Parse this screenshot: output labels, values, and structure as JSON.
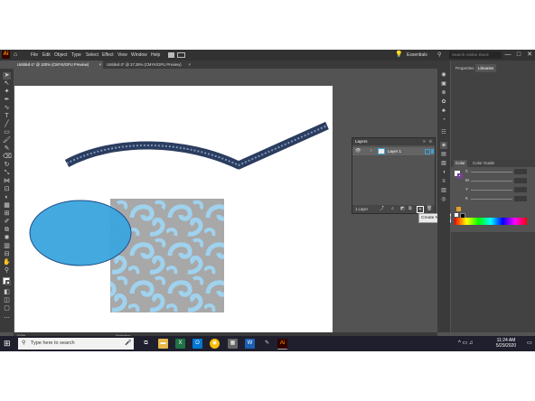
{
  "app": {
    "logo": "Ai",
    "menu": [
      "File",
      "Edit",
      "Object",
      "Type",
      "Select",
      "Effect",
      "View",
      "Window",
      "Help"
    ],
    "workspace": "Essentials",
    "search_placeholder": "Search Adobe Stock",
    "window_controls": [
      "—",
      "□",
      "✕"
    ]
  },
  "tabs": [
    {
      "label": "Untitled-1* @ 100% (CMYK/GPU Preview)",
      "close": "×"
    },
    {
      "label": "Untitled-2* @ 37.28% (CMYK/GPU Preview)",
      "close": "×"
    }
  ],
  "panels": {
    "top_tabs": [
      "Properties",
      "Libraries"
    ],
    "layers": {
      "tab": "Layers",
      "layer_name": "Layer 1",
      "footer_count": "1 Layer",
      "tooltip": "Create New Layer"
    },
    "color": {
      "tabs": [
        "Color",
        "Color Guide"
      ],
      "channels": [
        "C",
        "M",
        "Y",
        "K"
      ]
    }
  },
  "status": {
    "zoom": "100%",
    "tool": "Selection"
  },
  "taskbar": {
    "search_placeholder": "Type here to search",
    "time": "11:24 AM",
    "date": "5/29/2020"
  },
  "colors": {
    "stroke_path": "#2b3d5f",
    "ellipse_fill": "#3aa4dc",
    "pattern_bg": "#a8a8a8",
    "pattern_swirl": "#9fd2ee"
  }
}
